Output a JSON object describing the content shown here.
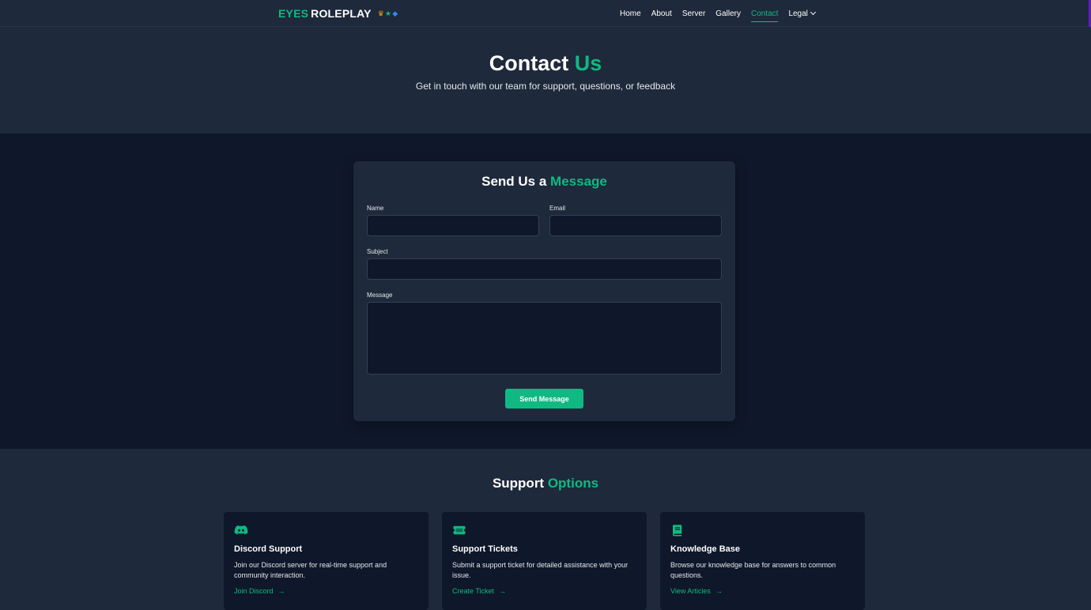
{
  "brand": {
    "part1": "EYES",
    "part2": "ROLEPLAY",
    "badges": [
      "crown-icon",
      "star-icon",
      "gem-icon"
    ]
  },
  "nav": {
    "items": [
      {
        "label": "Home",
        "active": false
      },
      {
        "label": "About",
        "active": false
      },
      {
        "label": "Server",
        "active": false
      },
      {
        "label": "Gallery",
        "active": false
      },
      {
        "label": "Contact",
        "active": true
      },
      {
        "label": "Legal",
        "active": false,
        "dropdown": true
      }
    ]
  },
  "hero": {
    "title_main": "Contact",
    "title_accent": "Us",
    "subtitle": "Get in touch with our team for support, questions, or feedback"
  },
  "form": {
    "title_main": "Send Us a",
    "title_accent": "Message",
    "name_label": "Name",
    "name_value": "",
    "email_label": "Email",
    "email_value": "",
    "subject_label": "Subject",
    "subject_value": "",
    "message_label": "Message",
    "message_value": "",
    "submit_label": "Send Message"
  },
  "support": {
    "title_main": "Support",
    "title_accent": "Options",
    "cards": [
      {
        "icon": "discord-icon",
        "title": "Discord Support",
        "description": "Join our Discord server for real-time support and community interaction.",
        "link": "Join Discord"
      },
      {
        "icon": "ticket-icon",
        "title": "Support Tickets",
        "description": "Submit a support ticket for detailed assistance with your issue.",
        "link": "Create Ticket"
      },
      {
        "icon": "book-icon",
        "title": "Knowledge Base",
        "description": "Browse our knowledge base for answers to common questions.",
        "link": "View Articles"
      }
    ]
  },
  "colors": {
    "accent": "#10b981",
    "page_bg": "#1e293b",
    "section_dark": "#0f172a"
  }
}
